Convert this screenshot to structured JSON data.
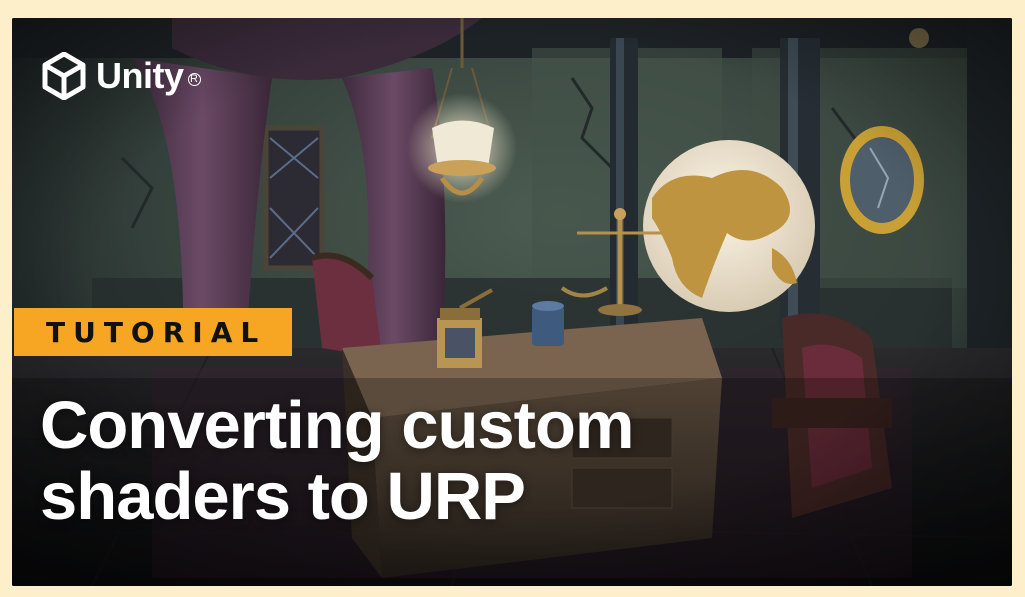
{
  "brand": {
    "name": "Unity",
    "registered_mark": "R",
    "logo_icon": "unity-cube-icon"
  },
  "badge": {
    "label": "TUTORIAL",
    "color": "#f6a623"
  },
  "title": {
    "line1": "Converting custom",
    "line2": "shaders to URP"
  },
  "scene": {
    "description_icon": "game-room-scene",
    "globe_labels": [
      "ASIA",
      "AFRICA"
    ]
  },
  "colors": {
    "outer_background": "#fcefc9",
    "title_text": "#ffffff",
    "badge_text": "#111111"
  }
}
